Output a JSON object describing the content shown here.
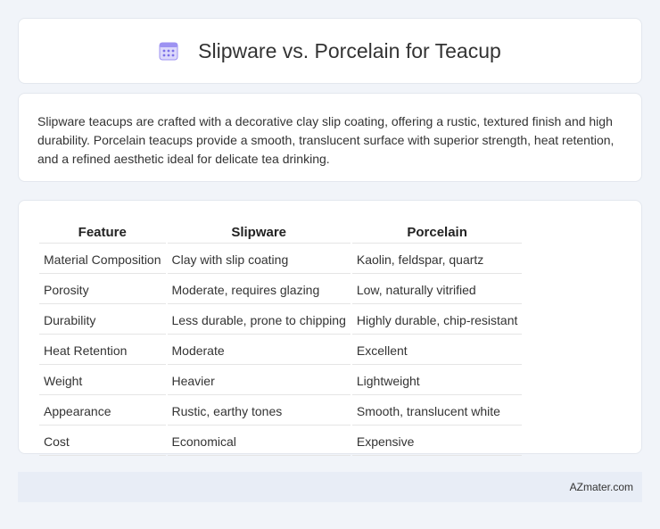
{
  "header": {
    "title": "Slipware vs. Porcelain for Teacup",
    "icon": "calendar-icon",
    "icon_color": "#8a7cf0"
  },
  "intro": {
    "text": "Slipware teacups are crafted with a decorative clay slip coating, offering a rustic, textured finish and high durability. Porcelain teacups provide a smooth, translucent surface with superior strength, heat retention, and a refined aesthetic ideal for delicate tea drinking."
  },
  "table": {
    "headers": [
      "Feature",
      "Slipware",
      "Porcelain"
    ],
    "rows": [
      [
        "Material Composition",
        "Clay with slip coating",
        "Kaolin, feldspar, quartz"
      ],
      [
        "Porosity",
        "Moderate, requires glazing",
        "Low, naturally vitrified"
      ],
      [
        "Durability",
        "Less durable, prone to chipping",
        "Highly durable, chip-resistant"
      ],
      [
        "Heat Retention",
        "Moderate",
        "Excellent"
      ],
      [
        "Weight",
        "Heavier",
        "Lightweight"
      ],
      [
        "Appearance",
        "Rustic, earthy tones",
        "Smooth, translucent white"
      ],
      [
        "Cost",
        "Economical",
        "Expensive"
      ]
    ]
  },
  "footer": {
    "brand": "AZmater.com"
  }
}
